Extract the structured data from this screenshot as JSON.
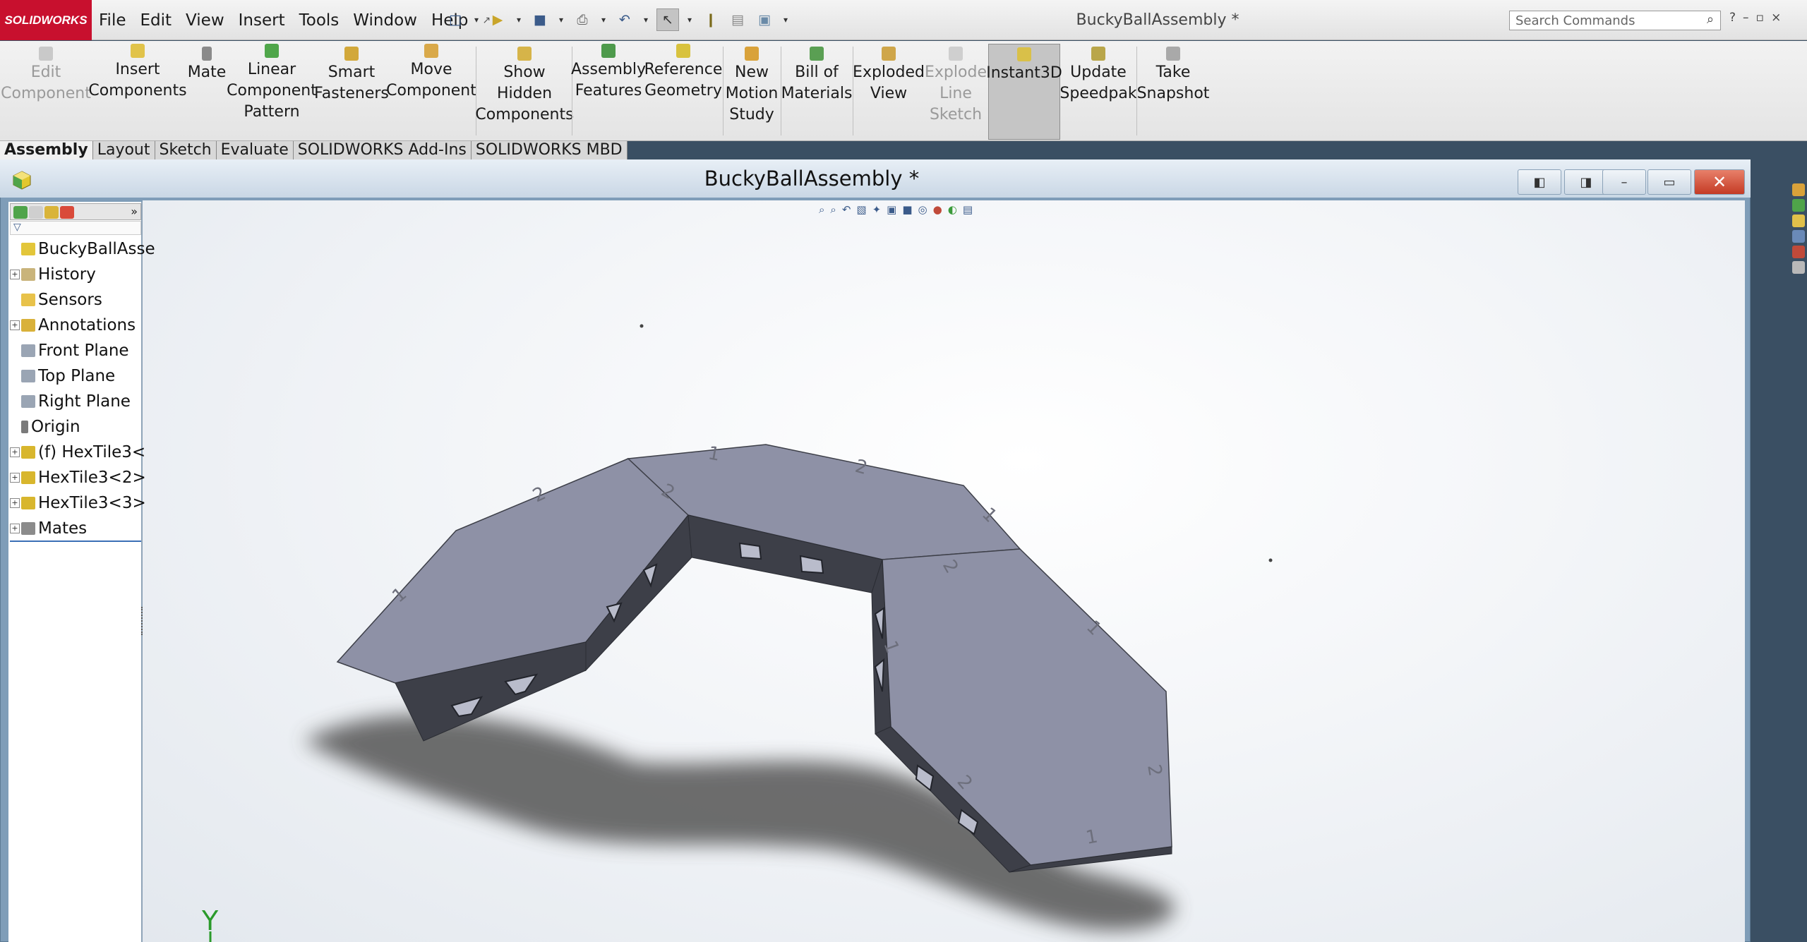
{
  "app": {
    "logo_text": "SOLIDWORKS",
    "menus": [
      "File",
      "Edit",
      "View",
      "Insert",
      "Tools",
      "Window",
      "Help"
    ],
    "document_title": "BuckyBallAssembly *",
    "search_placeholder": "Search Commands"
  },
  "command_manager": {
    "buttons": [
      {
        "label_lines": [
          "Edit",
          "Component"
        ],
        "disabled": true
      },
      {
        "label_lines": [
          "Insert",
          "Components"
        ]
      },
      {
        "label_lines": [
          "Mate"
        ]
      },
      {
        "label_lines": [
          "Linear",
          "Component",
          "Pattern"
        ]
      },
      {
        "label_lines": [
          "Smart",
          "Fasteners"
        ]
      },
      {
        "label_lines": [
          "Move",
          "Component"
        ]
      },
      {
        "label_lines": [
          "Show",
          "Hidden",
          "Components"
        ]
      },
      {
        "label_lines": [
          "Assembly",
          "Features"
        ]
      },
      {
        "label_lines": [
          "Reference",
          "Geometry"
        ]
      },
      {
        "label_lines": [
          "New",
          "Motion",
          "Study"
        ]
      },
      {
        "label_lines": [
          "Bill of",
          "Materials"
        ]
      },
      {
        "label_lines": [
          "Exploded",
          "View"
        ]
      },
      {
        "label_lines": [
          "Explode",
          "Line",
          "Sketch"
        ],
        "disabled": true
      },
      {
        "label_lines": [
          "Instant3D"
        ],
        "active": true
      },
      {
        "label_lines": [
          "Update",
          "Speedpak"
        ]
      },
      {
        "label_lines": [
          "Take",
          "Snapshot"
        ]
      }
    ]
  },
  "tabs": [
    "Assembly",
    "Layout",
    "Sketch",
    "Evaluate",
    "SOLIDWORKS Add-Ins",
    "SOLIDWORKS MBD"
  ],
  "document_window": {
    "caption": "BuckyBallAssembly *"
  },
  "feature_tree": {
    "nodes": [
      {
        "label": "BuckyBallAsse",
        "expand": false,
        "icon_color": "#e3c63a"
      },
      {
        "label": "History",
        "expand": true,
        "icon_color": "#c9b47b"
      },
      {
        "label": "Sensors",
        "expand": false,
        "icon_color": "#e8c24a"
      },
      {
        "label": "Annotations",
        "expand": true,
        "icon_color": "#d9b13a"
      },
      {
        "label": "Front Plane",
        "expand": false,
        "icon_color": "#9aa5b4"
      },
      {
        "label": "Top Plane",
        "expand": false,
        "icon_color": "#9aa5b4"
      },
      {
        "label": "Right Plane",
        "expand": false,
        "icon_color": "#9aa5b4"
      },
      {
        "label": "Origin",
        "expand": false,
        "icon_color": "#7a7a7a"
      },
      {
        "label": "(f) HexTile3<",
        "expand": true,
        "icon_color": "#d8b62d"
      },
      {
        "label": "HexTile3<2>",
        "expand": true,
        "icon_color": "#d8b62d"
      },
      {
        "label": "HexTile3<3>",
        "expand": true,
        "icon_color": "#d8b62d"
      },
      {
        "label": "Mates",
        "expand": true,
        "icon_color": "#8b8b8b"
      }
    ]
  },
  "viewport": {
    "triad_y_label": "Y",
    "model_color": "#8e91a6",
    "edge_color": "#3d3f48",
    "shadow_color": "#555555",
    "edge_numbers": [
      "1",
      "2",
      "1",
      "2",
      "1",
      "2",
      "1",
      "2",
      "1",
      "2",
      "1",
      "2"
    ]
  }
}
